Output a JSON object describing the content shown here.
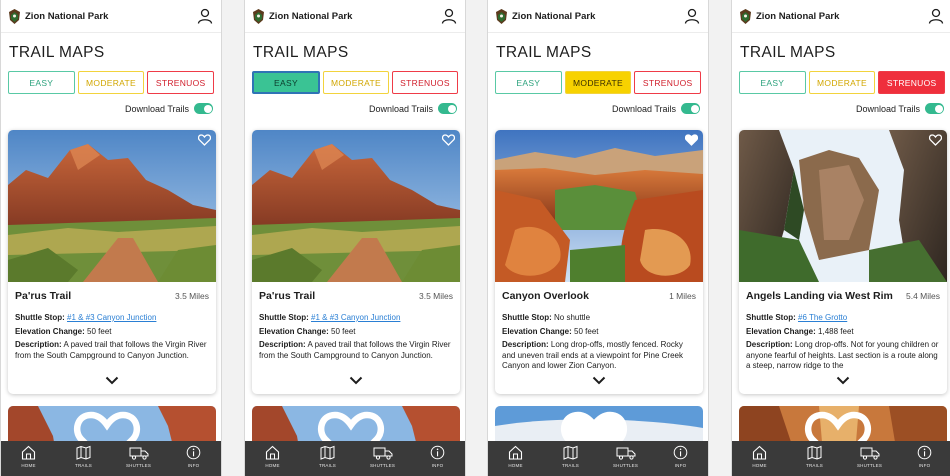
{
  "app": {
    "park_name": "Zion National Park",
    "page_title": "TRAIL MAPS",
    "difficulty": {
      "easy": "EASY",
      "moderate": "MODERATE",
      "strenuous": "STRENUOS"
    },
    "download_label": "Download Trails",
    "download_enabled": true,
    "labels": {
      "shuttle": "Shuttle Stop:",
      "elevation": "Elevation Change:",
      "description": "Description:"
    },
    "nav": [
      "HOME",
      "TRAILS",
      "SHUTTLES",
      "INFO"
    ]
  },
  "screens": [
    {
      "selected_difficulty": "none",
      "trail": {
        "name": "Pa'rus Trail",
        "distance": "3.5 Miles",
        "shuttle": "#1 & #3 Canyon Junction",
        "shuttle_is_link": true,
        "elevation": "50 feet",
        "description": "A paved trail that follows the Virgin River from the South Campground to Canyon Junction."
      }
    },
    {
      "selected_difficulty": "easy",
      "trail": {
        "name": "Pa'rus Trail",
        "distance": "3.5 Miles",
        "shuttle": "#1 & #3 Canyon Junction",
        "shuttle_is_link": true,
        "elevation": "50 feet",
        "description": "A paved trail that follows the Virgin River from the South Campground to Canyon Junction."
      }
    },
    {
      "selected_difficulty": "moderate",
      "trail": {
        "name": "Canyon Overlook",
        "distance": "1 Miles",
        "shuttle": "No shuttle",
        "shuttle_is_link": false,
        "elevation": "50 feet",
        "description": "Long drop-offs, mostly fenced. Rocky and uneven trail ends at a viewpoint for Pine Creek Canyon and lower Zion Canyon."
      }
    },
    {
      "selected_difficulty": "strenuous",
      "trail": {
        "name": "Angels Landing via West Rim",
        "distance": "5.4 Miles",
        "shuttle": "#6 The Grotto",
        "shuttle_is_link": true,
        "elevation": "1,488 feet",
        "description": "Long drop-offs. Not for young children or anyone fearful of heights. Last section is a route along a steep, narrow ridge to the"
      }
    }
  ],
  "colors": {
    "easy": "#3ac394",
    "moderate": "#f7d200",
    "strenuous": "#ef2f3c",
    "toggle": "#34b98f",
    "link": "#2a7fd4",
    "navbar": "#3a3a3a"
  },
  "icons": [
    "nps-arrowhead-icon",
    "user-icon",
    "heart-icon",
    "chevron-down-icon",
    "home-icon",
    "map-icon",
    "truck-icon",
    "info-icon"
  ]
}
